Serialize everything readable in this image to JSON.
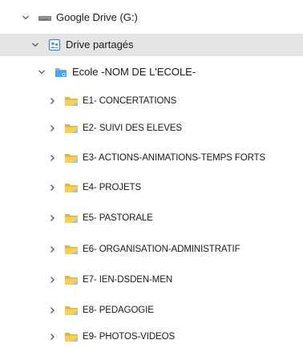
{
  "tree": {
    "root": {
      "label": "Google Drive (G:)",
      "icon": "drive-icon",
      "expanded": true
    },
    "shared": {
      "label": "Drive partagés",
      "icon": "shared-drives-icon",
      "expanded": true,
      "selected": true
    },
    "school": {
      "label": "Ecole -NOM DE L'ECOLE-",
      "icon": "shared-drive-icon",
      "expanded": true
    },
    "folders": [
      {
        "label": "E1- CONCERTATIONS"
      },
      {
        "label": "E2- SUIVI DES ELEVES"
      },
      {
        "label": "E3- ACTIONS-ANIMATIONS-TEMPS FORTS"
      },
      {
        "label": "E4- PROJETS"
      },
      {
        "label": "E5- PASTORALE"
      },
      {
        "label": "E6- ORGANISATION-ADMINISTRATIF"
      },
      {
        "label": "E7- IEN-DSDEN-MEN"
      },
      {
        "label": "E8- PEDAGOGIE"
      },
      {
        "label": "E9- PHOTOS-VIDEOS"
      }
    ]
  },
  "colors": {
    "selection": "#e5e5e5",
    "chevron": "#5a5a5a",
    "folder_yellow": "#f5c542",
    "folder_blue": "#4da3e8"
  }
}
